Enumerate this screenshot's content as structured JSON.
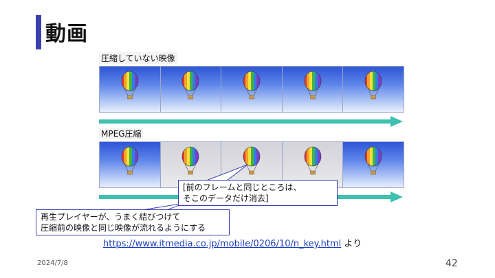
{
  "slide": {
    "title": "動画",
    "date": "2024/7/8",
    "page_number": "42"
  },
  "uncompressed": {
    "label": "圧縮していない映像",
    "frames": [
      "full",
      "full",
      "full",
      "full",
      "full"
    ]
  },
  "mpeg": {
    "label": "MPEG圧縮",
    "frames": [
      "full",
      "diff",
      "diff",
      "diff",
      "full"
    ]
  },
  "callouts": {
    "diff_note": "[前のフレームと同じところは、\nそこのデータだけ消去]",
    "player_note": "再生プレイヤーが、うまく結びつけて\n圧縮前の映像と同じ映像が流れるようにする"
  },
  "source": {
    "url": "https://www.itmedia.co.jp/mobile/0206/10/n_key.html",
    "suffix": " より"
  },
  "colors": {
    "accent": "#3a3fb0",
    "arrow": "#3fc1b0",
    "link": "#1a3fb8"
  }
}
